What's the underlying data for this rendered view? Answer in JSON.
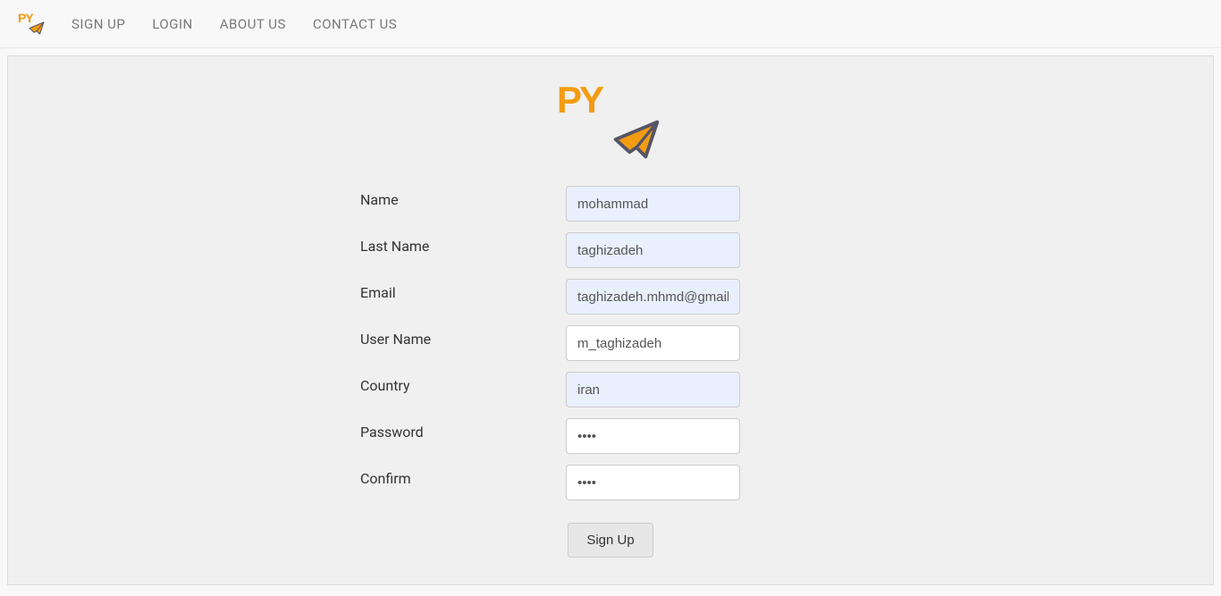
{
  "nav": {
    "signup": "SIGN UP",
    "login": "LOGIN",
    "about": "ABOUT US",
    "contact": "CONTACT US"
  },
  "logo": {
    "text": "PY"
  },
  "form": {
    "labels": {
      "name": "Name",
      "lastname": "Last Name",
      "email": "Email",
      "username": "User Name",
      "country": "Country",
      "password": "Password",
      "confirm": "Confirm"
    },
    "values": {
      "name": "mohammad",
      "lastname": "taghizadeh",
      "email": "taghizadeh.mhmd@gmail.com",
      "username": "m_taghizadeh",
      "country": "iran",
      "password": "••••",
      "confirm": "••••"
    },
    "submit": "Sign Up"
  }
}
